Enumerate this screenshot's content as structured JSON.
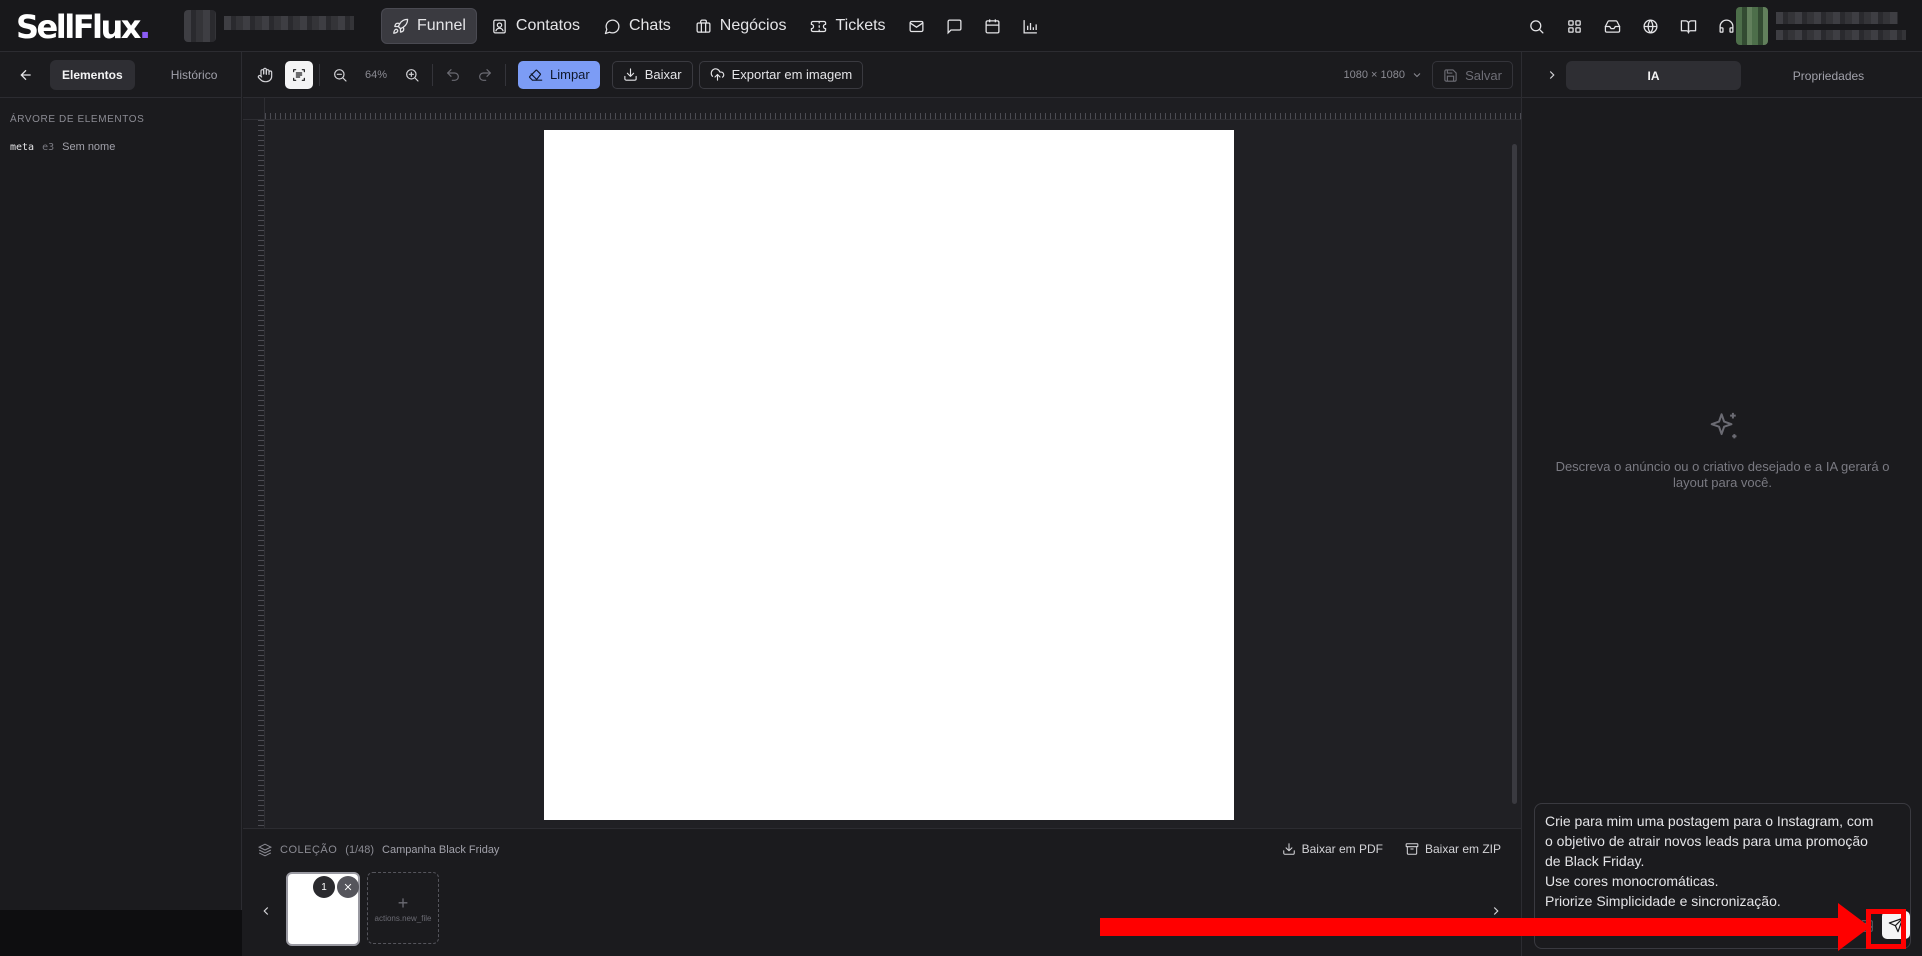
{
  "app": {
    "logo_text": "SellFlux",
    "logo_dot": "."
  },
  "nav": {
    "items": [
      {
        "label": "Funnel",
        "icon": "rocket-icon",
        "active": true
      },
      {
        "label": "Contatos",
        "icon": "contact-icon"
      },
      {
        "label": "Chats",
        "icon": "chat-bubble-icon"
      },
      {
        "label": "Negócios",
        "icon": "briefcase-icon"
      },
      {
        "label": "Tickets",
        "icon": "ticket-icon"
      }
    ],
    "extra_icons": [
      "mail-icon",
      "message-square-icon",
      "calendar-icon",
      "bar-chart-icon"
    ],
    "right_icons": [
      "search-icon",
      "grid-icon",
      "inbox-icon",
      "globe-icon",
      "book-icon",
      "headset-icon"
    ]
  },
  "left_panel": {
    "tabs": [
      {
        "label": "Elementos",
        "active": true
      },
      {
        "label": "Histórico"
      }
    ],
    "tree_title": "ÁRVORE DE ELEMENTOS",
    "tree_items": [
      {
        "type": "meta",
        "id": "e3",
        "name": "Sem nome"
      }
    ]
  },
  "toolbar": {
    "zoom": "64%",
    "clear_label": "Limpar",
    "download_label": "Baixar",
    "export_label": "Exportar em imagem",
    "canvas_size": "1080 × 1080",
    "save_label": "Salvar"
  },
  "collection": {
    "label": "COLEÇÃO",
    "count": "(1/48)",
    "name": "Campanha Black Friday",
    "pdf_label": "Baixar em PDF",
    "zip_label": "Baixar em ZIP",
    "thumb_number": "1",
    "new_file_label": "actions.new_file"
  },
  "right_panel": {
    "tabs": [
      {
        "label": "IA",
        "active": true
      },
      {
        "label": "Propriedades"
      }
    ],
    "empty_hint": "Descreva o anúncio ou o criativo desejado e a IA gerará o layout para você.",
    "prompt": "Crie para mim uma postagem para o Instagram, com o objetivo de atrair novos leads para uma promoção de Black Friday.\nUse cores monocromáticas.\nPriorize Simplicidade e sincronização."
  },
  "colors": {
    "accent": "#7c9cf5",
    "logo_dot": "#8b5cf6",
    "annotation": "#ff0000",
    "background": "#1b1b1e"
  }
}
